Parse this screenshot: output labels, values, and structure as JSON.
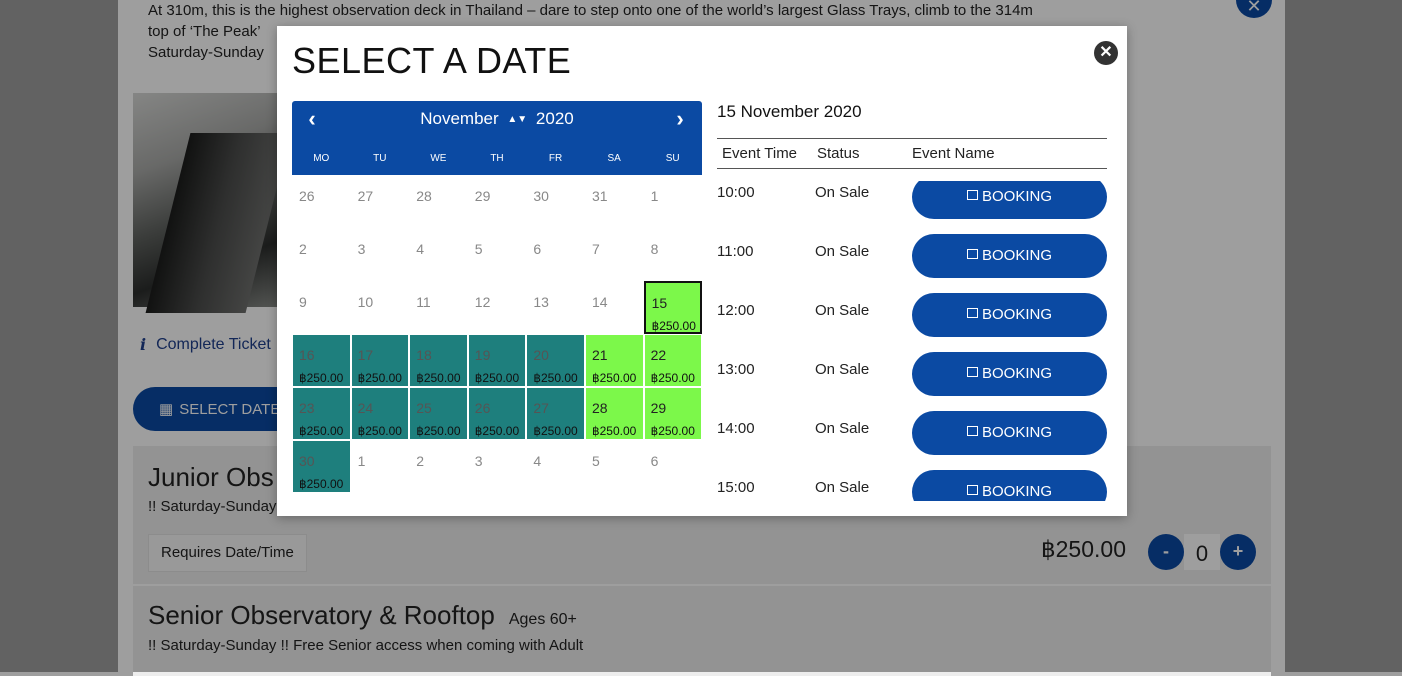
{
  "background": {
    "intro_lines": [
      "At 310m, this is the highest observation deck in Thailand – dare to step onto one of the world’s largest Glass Trays, climb to the 314m",
      "top of ‘The Peak’                                                                                                                                               !!",
      "Saturday-Sunday"
    ],
    "info_link": "Complete Ticket",
    "select_button": "SELECT DATE/T",
    "junior": {
      "title": "Junior Obs",
      "subtitle": "!! Saturday-Sunday",
      "requires": "Requires Date/Time",
      "price": "฿250.00",
      "qty": "0",
      "minus": "-",
      "plus": "+"
    },
    "senior": {
      "title": "Senior Observatory & Rooftop",
      "age": "Ages 60+",
      "subtitle": "!! Saturday-Sunday !! Free Senior access when coming with Adult"
    }
  },
  "modal": {
    "title": "SELECT A DATE",
    "close_icon": "close-icon",
    "calendar": {
      "month": "November",
      "year": "2020",
      "prev_icon": "chevron-left-icon",
      "next_icon": "chevron-right-icon",
      "weekdays": [
        "MO",
        "TU",
        "WE",
        "TH",
        "FR",
        "SA",
        "SU"
      ],
      "days": [
        {
          "d": "26",
          "p": "",
          "s": "other"
        },
        {
          "d": "27",
          "p": "",
          "s": "other"
        },
        {
          "d": "28",
          "p": "",
          "s": "other"
        },
        {
          "d": "29",
          "p": "",
          "s": "other"
        },
        {
          "d": "30",
          "p": "",
          "s": "other"
        },
        {
          "d": "31",
          "p": "",
          "s": "other"
        },
        {
          "d": "1",
          "p": "",
          "s": "normal"
        },
        {
          "d": "2",
          "p": "",
          "s": "normal"
        },
        {
          "d": "3",
          "p": "",
          "s": "normal"
        },
        {
          "d": "4",
          "p": "",
          "s": "normal"
        },
        {
          "d": "5",
          "p": "",
          "s": "normal"
        },
        {
          "d": "6",
          "p": "",
          "s": "normal"
        },
        {
          "d": "7",
          "p": "",
          "s": "normal"
        },
        {
          "d": "8",
          "p": "",
          "s": "normal"
        },
        {
          "d": "9",
          "p": "",
          "s": "normal"
        },
        {
          "d": "10",
          "p": "",
          "s": "normal"
        },
        {
          "d": "11",
          "p": "",
          "s": "normal"
        },
        {
          "d": "12",
          "p": "",
          "s": "normal"
        },
        {
          "d": "13",
          "p": "",
          "s": "normal"
        },
        {
          "d": "14",
          "p": "",
          "s": "normal"
        },
        {
          "d": "15",
          "p": "฿250.00",
          "s": "selected"
        },
        {
          "d": "16",
          "p": "฿250.00",
          "s": "teal"
        },
        {
          "d": "17",
          "p": "฿250.00",
          "s": "teal"
        },
        {
          "d": "18",
          "p": "฿250.00",
          "s": "teal"
        },
        {
          "d": "19",
          "p": "฿250.00",
          "s": "teal"
        },
        {
          "d": "20",
          "p": "฿250.00",
          "s": "teal"
        },
        {
          "d": "21",
          "p": "฿250.00",
          "s": "green"
        },
        {
          "d": "22",
          "p": "฿250.00",
          "s": "green"
        },
        {
          "d": "23",
          "p": "฿250.00",
          "s": "teal"
        },
        {
          "d": "24",
          "p": "฿250.00",
          "s": "teal"
        },
        {
          "d": "25",
          "p": "฿250.00",
          "s": "teal"
        },
        {
          "d": "26",
          "p": "฿250.00",
          "s": "teal"
        },
        {
          "d": "27",
          "p": "฿250.00",
          "s": "teal"
        },
        {
          "d": "28",
          "p": "฿250.00",
          "s": "green"
        },
        {
          "d": "29",
          "p": "฿250.00",
          "s": "green"
        },
        {
          "d": "30",
          "p": "฿250.00",
          "s": "teal"
        },
        {
          "d": "1",
          "p": "",
          "s": "other"
        },
        {
          "d": "2",
          "p": "",
          "s": "other"
        },
        {
          "d": "3",
          "p": "",
          "s": "other"
        },
        {
          "d": "4",
          "p": "",
          "s": "other"
        },
        {
          "d": "5",
          "p": "",
          "s": "other"
        },
        {
          "d": "6",
          "p": "",
          "s": "other"
        }
      ]
    },
    "events": {
      "date": "15 November 2020",
      "headers": {
        "time": "Event Time",
        "status": "Status",
        "name": "Event Name"
      },
      "book_label": "BOOKING",
      "rows": [
        {
          "time": "10:00",
          "status": "On Sale"
        },
        {
          "time": "11:00",
          "status": "On Sale"
        },
        {
          "time": "12:00",
          "status": "On Sale"
        },
        {
          "time": "13:00",
          "status": "On Sale"
        },
        {
          "time": "14:00",
          "status": "On Sale"
        },
        {
          "time": "15:00",
          "status": "On Sale"
        }
      ]
    }
  },
  "colors": {
    "accent": "#0b4aa3",
    "teal": "#1e7f7d",
    "green": "#7cf84a"
  }
}
